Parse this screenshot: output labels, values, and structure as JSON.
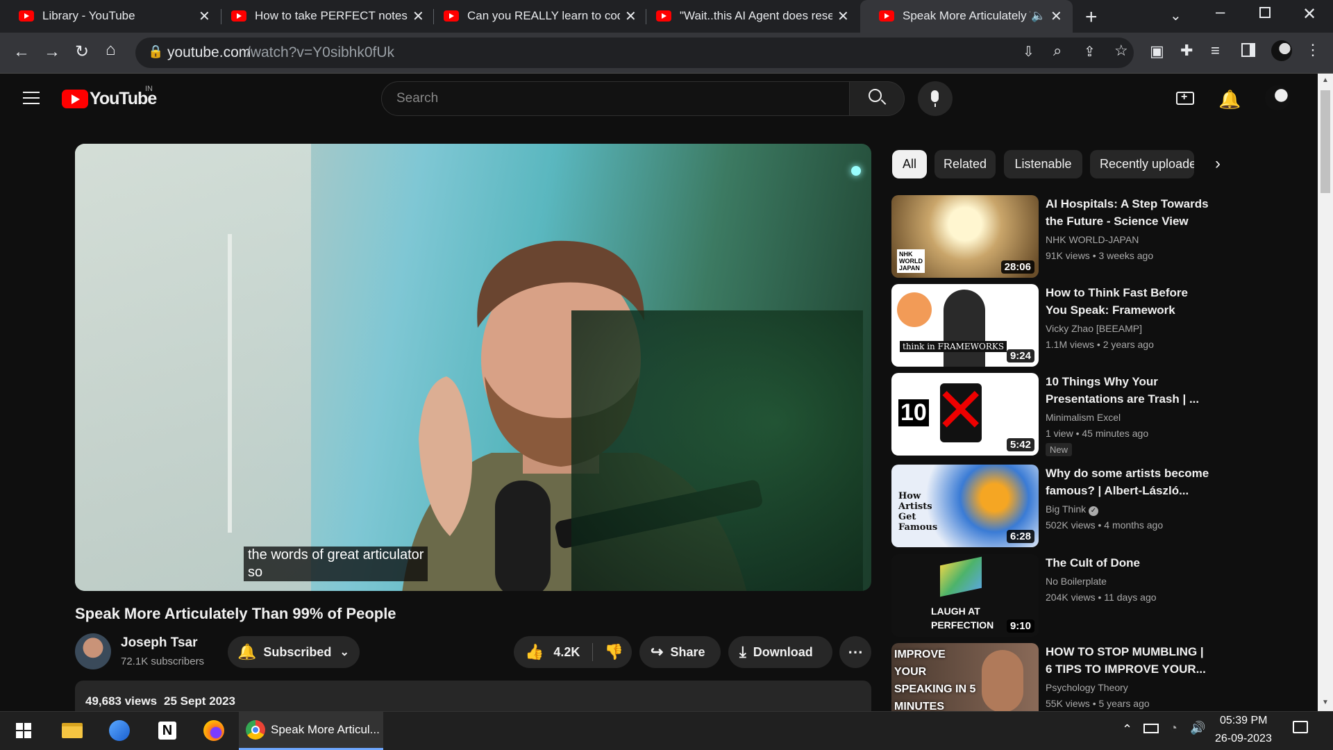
{
  "browser": {
    "tabs": [
      {
        "title": "Library - YouTube"
      },
      {
        "title": "How to take PERFECT notes w"
      },
      {
        "title": "Can you REALLY learn to code"
      },
      {
        "title": "\"Wait..this AI Agent does rese"
      },
      {
        "title": "Speak More Articulately T"
      }
    ],
    "url_domain": "youtube.com",
    "url_path": "/watch?v=Y0sibhk0fUk"
  },
  "youtube": {
    "logo_text": "YouTube",
    "region": "IN",
    "search_placeholder": "Search"
  },
  "video": {
    "caption_line1": "the words of great articulator",
    "caption_line2": "so",
    "title": "Speak More Articulately Than 99% of People",
    "channel": "Joseph Tsar",
    "subscribers": "72.1K subscribers",
    "subscribe_label": "Subscribed",
    "likes": "4.2K",
    "share_label": "Share",
    "download_label": "Download",
    "views": "49,683 views",
    "date": "25 Sept 2023"
  },
  "filters": [
    "All",
    "Related",
    "Listenable",
    "Recently uploaded"
  ],
  "recommendations": [
    {
      "title": "AI Hospitals: A Step Towards the Future - Science View",
      "channel": "NHK WORLD-JAPAN",
      "views": "91K views",
      "age": "3 weeks ago",
      "duration": "28:06",
      "thumb_text": "NHK WORLD JAPAN"
    },
    {
      "title": "How to Think Fast Before You Speak: Framework Thinking",
      "channel": "Vicky Zhao [BEEAMP]",
      "views": "1.1M views",
      "age": "2 years ago",
      "duration": "9:24",
      "thumb_text": "think in FRAMEWORKS"
    },
    {
      "title": "10 Things Why Your Presentations are Trash | ...",
      "channel": "Minimalism Excel",
      "views": "1 view",
      "age": "45 minutes ago",
      "duration": "5:42",
      "badge": "New",
      "thumb_text": "10"
    },
    {
      "title": "Why do some artists become famous? | Albert-László...",
      "channel": "Big Think",
      "views": "502K views",
      "age": "4 months ago",
      "duration": "6:28",
      "thumb_text": "How Artists Get Famous"
    },
    {
      "title": "The Cult of Done",
      "channel": "No Boilerplate",
      "views": "204K views",
      "age": "11 days ago",
      "duration": "9:10",
      "thumb_text": "LAUGH AT PERFECTION"
    },
    {
      "title": "HOW TO STOP MUMBLING | 6 TIPS TO IMPROVE YOUR...",
      "channel": "Psychology Theory",
      "views": "55K views",
      "age": "5 years ago",
      "duration": "",
      "thumb_text": "IMPROVE YOUR SPEAKING IN 5 MINUTES"
    }
  ],
  "taskbar": {
    "active_window": "Speak More Articul...",
    "time": "05:39 PM",
    "date": "26-09-2023"
  }
}
